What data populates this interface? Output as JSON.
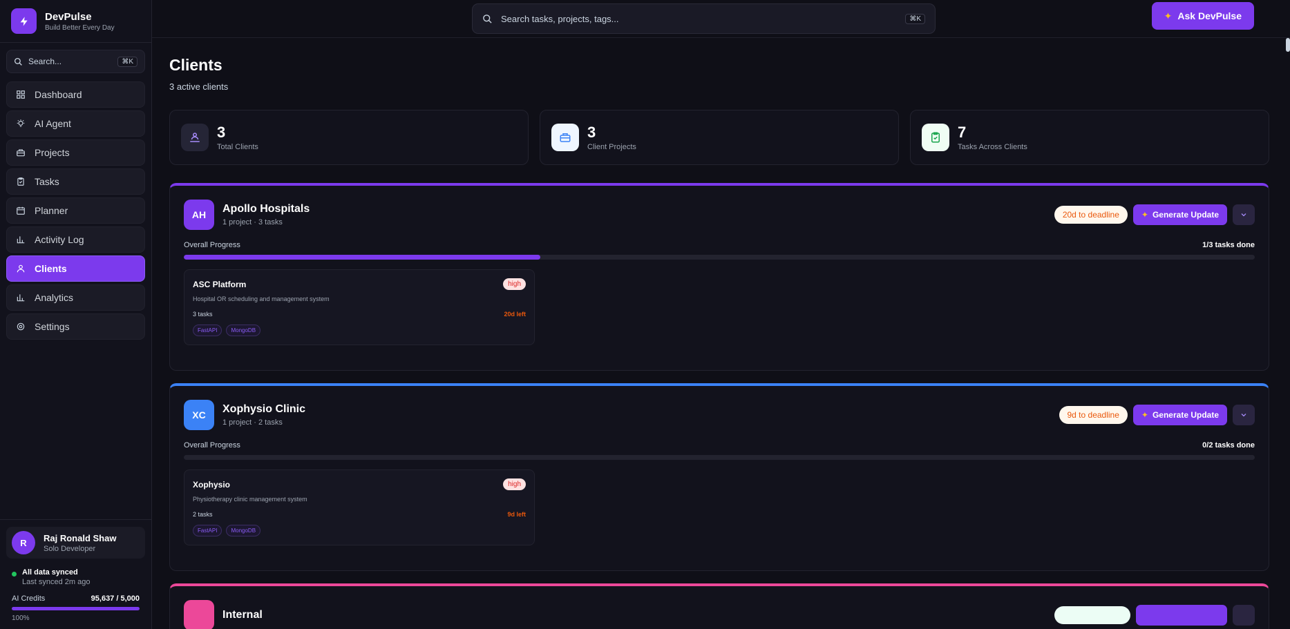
{
  "brand": {
    "name": "DevPulse",
    "tagline": "Build Better Every Day"
  },
  "sidebar": {
    "search_placeholder": "Search...",
    "search_shortcut": "⌘K",
    "items": [
      {
        "label": "Dashboard",
        "icon": "grid-icon"
      },
      {
        "label": "AI Agent",
        "icon": "bulb-icon"
      },
      {
        "label": "Projects",
        "icon": "briefcase-icon"
      },
      {
        "label": "Tasks",
        "icon": "clipboard-icon"
      },
      {
        "label": "Planner",
        "icon": "calendar-icon"
      },
      {
        "label": "Activity Log",
        "icon": "bar-chart-icon"
      },
      {
        "label": "Clients",
        "icon": "user-icon",
        "active": true
      },
      {
        "label": "Analytics",
        "icon": "bar-chart-icon"
      },
      {
        "label": "Settings",
        "icon": "gear-icon"
      }
    ],
    "user": {
      "initial": "R",
      "name": "Raj Ronald Shaw",
      "role": "Solo Developer"
    },
    "sync": {
      "title": "All data synced",
      "subtitle": "Last synced 2m ago"
    },
    "credits": {
      "label": "AI Credits",
      "value": "95,637 / 5,000",
      "percent_label": "100%",
      "fill_percent": 100
    }
  },
  "topbar": {
    "search_placeholder": "Search tasks, projects, tags...",
    "search_shortcut": "⌘K",
    "ask_label": "Ask DevPulse"
  },
  "page": {
    "title": "Clients",
    "subtitle": "3 active clients"
  },
  "stats": [
    {
      "value": "3",
      "label": "Total Clients"
    },
    {
      "value": "3",
      "label": "Client Projects"
    },
    {
      "value": "7",
      "label": "Tasks Across Clients"
    }
  ],
  "clients": [
    {
      "initials": "AH",
      "name": "Apollo Hospitals",
      "meta": "1 project · 3 tasks",
      "deadline": "20d to deadline",
      "generate_label": "Generate Update",
      "progress_label": "Overall Progress",
      "progress_value": "1/3 tasks done",
      "progress_fraction": 0.333,
      "accent": "#7c3aed",
      "project": {
        "name": "ASC Platform",
        "priority": "high",
        "description": "Hospital OR scheduling and management system",
        "task_count": "3 tasks",
        "time_left": "20d left",
        "tags": [
          "FastAPI",
          "MongoDB"
        ]
      }
    },
    {
      "initials": "XC",
      "name": "Xophysio Clinic",
      "meta": "1 project · 2 tasks",
      "deadline": "9d to deadline",
      "generate_label": "Generate Update",
      "progress_label": "Overall Progress",
      "progress_value": "0/2 tasks done",
      "progress_fraction": 0,
      "accent": "#3b82f6",
      "project": {
        "name": "Xophysio",
        "priority": "high",
        "description": "Physiotherapy clinic management system",
        "task_count": "2 tasks",
        "time_left": "9d left",
        "tags": [
          "FastAPI",
          "MongoDB"
        ]
      }
    },
    {
      "initials": "",
      "name": "Internal",
      "accent": "#ec4899"
    }
  ],
  "colors": {
    "accent": "#7c3aed",
    "blue": "#3b82f6",
    "pink": "#ec4899",
    "warning": "#ea580c",
    "success": "#22c55e"
  }
}
